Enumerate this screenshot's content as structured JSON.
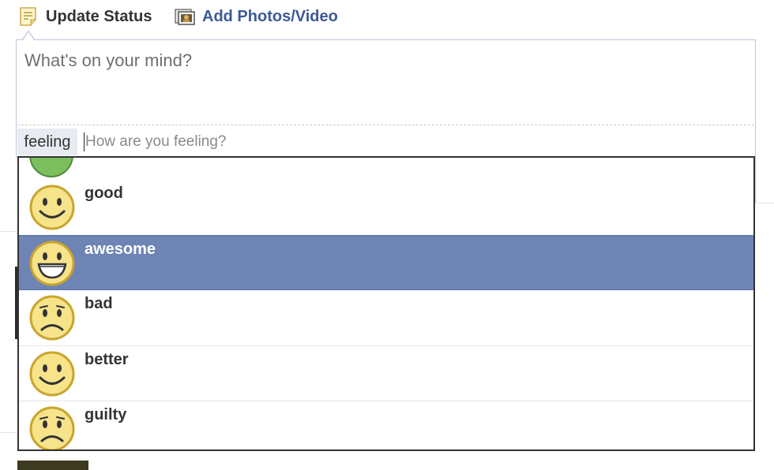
{
  "tabs": {
    "update_status": "Update Status",
    "add_photos": "Add Photos/Video"
  },
  "composer": {
    "placeholder": "What's on your mind?",
    "feeling_tag": "feeling",
    "feeling_placeholder": "How are you feeling?"
  },
  "dropdown": {
    "items": [
      {
        "label": "good",
        "icon": "smile-icon",
        "selected": false
      },
      {
        "label": "awesome",
        "icon": "grin-icon",
        "selected": true
      },
      {
        "label": "bad",
        "icon": "frown-icon",
        "selected": false
      },
      {
        "label": "better",
        "icon": "smile-icon",
        "selected": false
      },
      {
        "label": "guilty",
        "icon": "frown-icon",
        "selected": false
      }
    ]
  },
  "colors": {
    "link": "#3b5998",
    "selected_bg": "#6d84b4",
    "face_fill": "#f6e38a",
    "face_stroke": "#c9a52c",
    "partial_face": "#7bbf5e"
  }
}
